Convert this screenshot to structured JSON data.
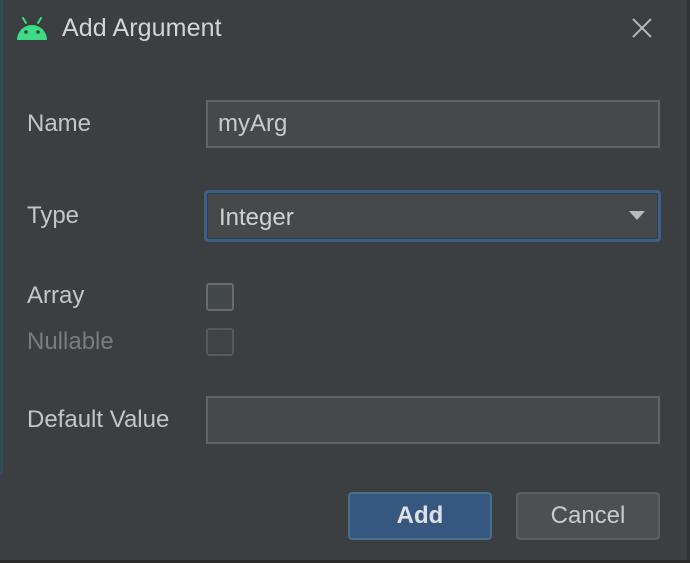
{
  "window": {
    "title": "Add Argument",
    "icon": "android-icon",
    "close_icon": "close-icon"
  },
  "form": {
    "name": {
      "label": "Name",
      "value": "myArg"
    },
    "type": {
      "label": "Type",
      "selected": "Integer"
    },
    "array": {
      "label": "Array",
      "checked": false
    },
    "nullable": {
      "label": "Nullable",
      "checked": false,
      "disabled": true
    },
    "default_value": {
      "label": "Default Value",
      "value": ""
    }
  },
  "buttons": {
    "add_label": "Add",
    "cancel_label": "Cancel"
  },
  "colors": {
    "background": "#3c3f41",
    "android_green": "#3ddc84",
    "primary_button": "#365880",
    "focus_border": "#3d6185"
  }
}
